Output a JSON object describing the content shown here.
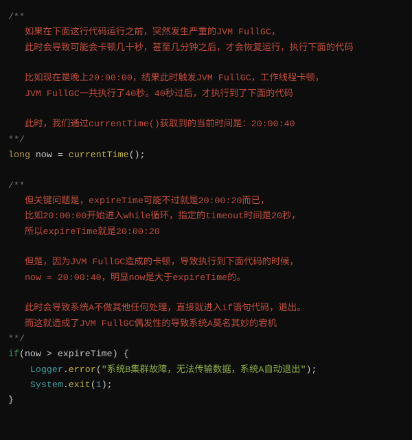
{
  "code": {
    "c1_open": "/**",
    "c1_l1": "   如果在下面这行代码运行之前，突然发生严重的JVM FullGC，",
    "c1_l2": "   此时会导致可能会卡顿几十秒，甚至几分钟之后，才会恢复运行，执行下面的代码",
    "c1_l3": "   比如现在是晚上20:00:00，结果此时触发JVM FullGC，工作线程卡顿，",
    "c1_l4": "   JVM FullGC一共执行了40秒。40秒过后，才执行到了下面的代码",
    "c1_l5": "   此时，我们通过currentTime()获取到的当前时间是：20:00:40",
    "c1_close": "**/",
    "kw_long": "long",
    "id_now": " now ",
    "punc_eq": "= ",
    "fn_currentTime": "currentTime",
    "call_tail": "();",
    "c2_open": "/**",
    "c2_l1": "   但关键问题是，expireTime可能不过就是20:00:20而已，",
    "c2_l2": "   比如20:00:00开始进入while循环，指定的timeout时间是20秒，",
    "c2_l3": "   所以expireTime就是20:00:20",
    "c2_l4": "   但是，因为JVM FullGC造成的卡顿，导致执行到下面代码的时候，",
    "c2_l5": "   now = 20:00:40，明显now是大于expireTime的。",
    "c2_l6": "   此时会导致系统A不做其他任何处理，直接就进入if语句代码，退出。",
    "c2_l7": "   而这就造成了JVM FullGC偶发性的导致系统A莫名其妙的宕机",
    "c2_close": "**/",
    "kw_if": "if",
    "if_line": "(now > expireTime) {",
    "cls_logger": "Logger",
    "dot": ".",
    "fn_error": "error",
    "lparen": "(",
    "err_str": "\"系统B集群故障，无法传输数据，系统A自动退出\"",
    "rparen_semi": ");",
    "cls_system": "System",
    "fn_exit": "exit",
    "num_1": "1",
    "rbrace": "}"
  }
}
